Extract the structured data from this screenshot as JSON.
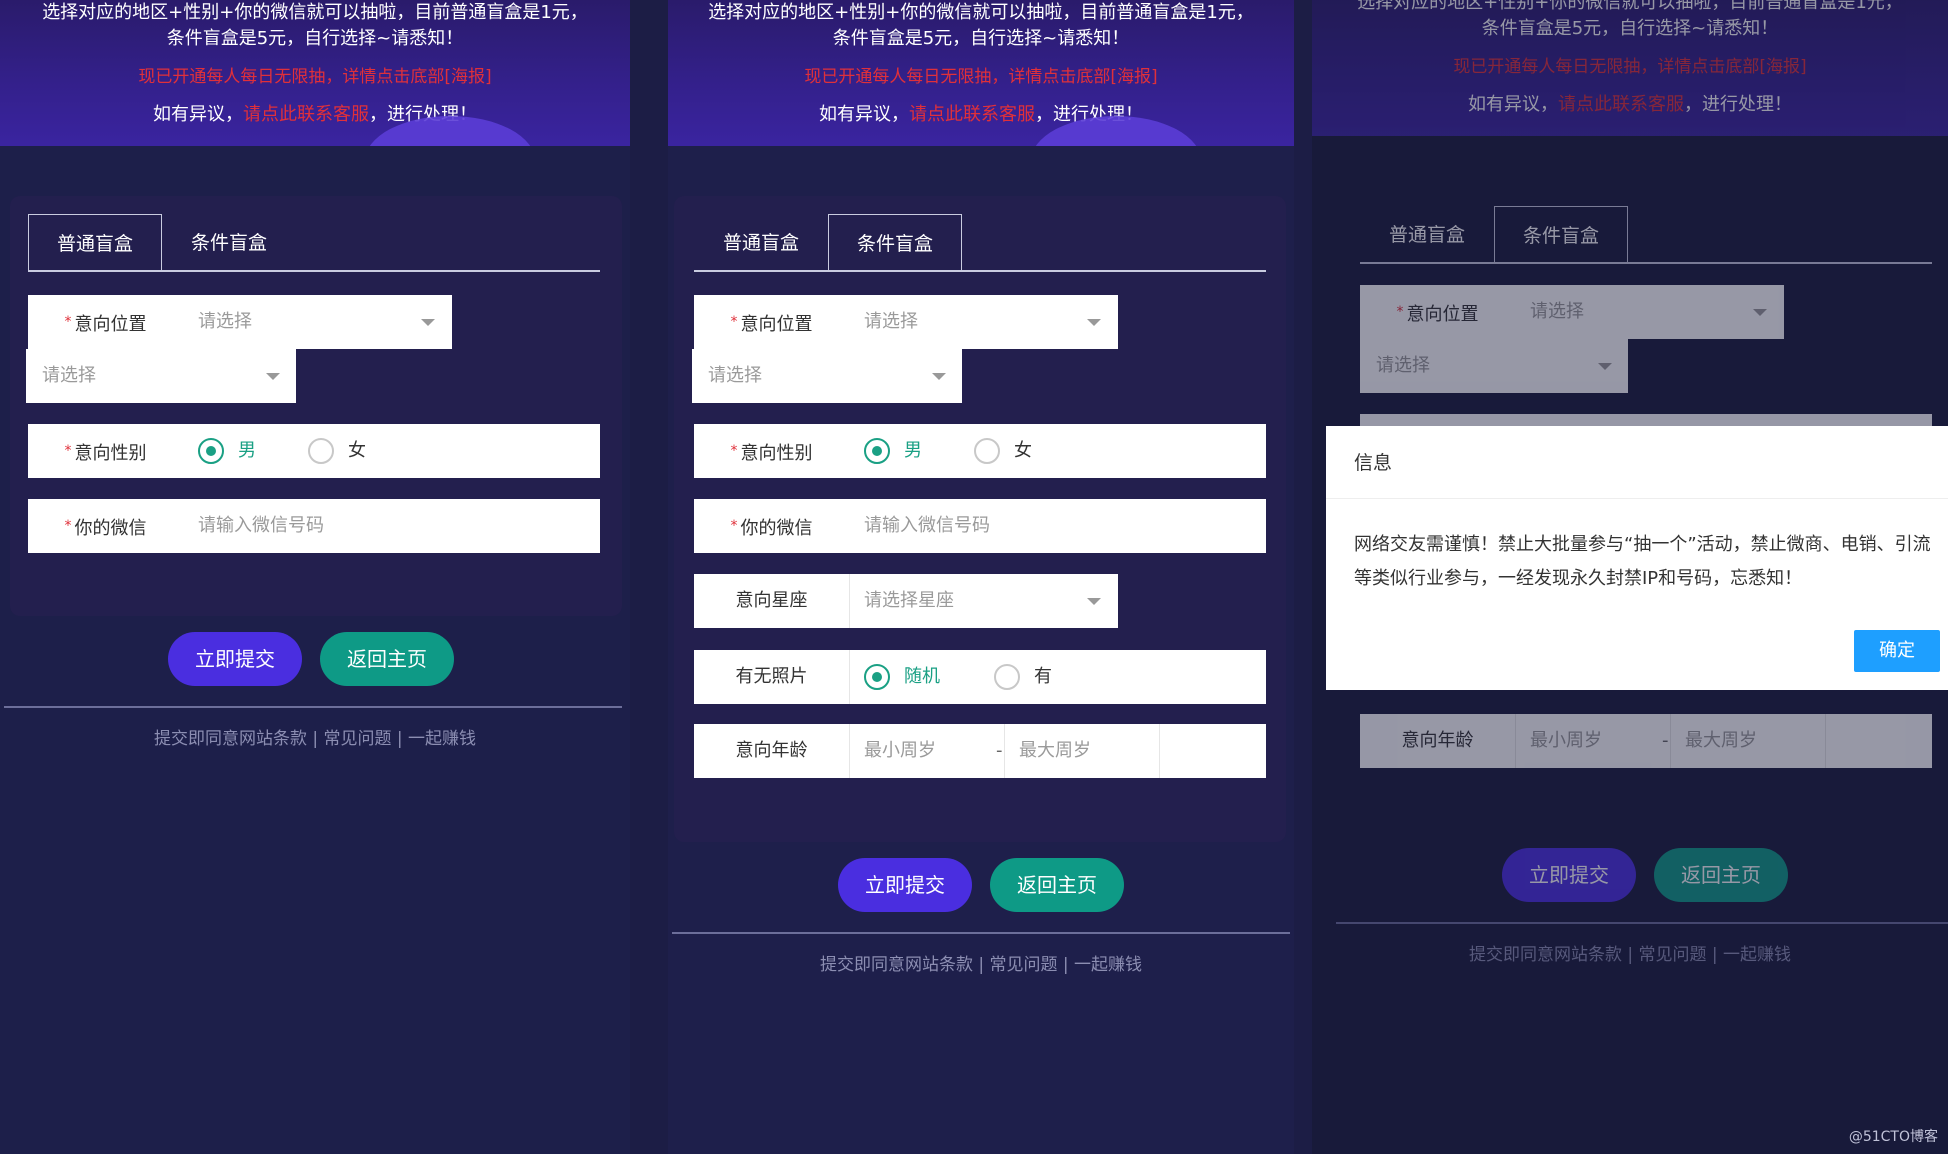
{
  "banner": {
    "line1": "选择对应的地区+性别+你的微信就可以抽啦，目前普通盲盒是1元，",
    "line2": "条件盲盒是5元，自行选择~请悉知！",
    "notice": "现已开通每人每日无限抽，详情点击底部[海报]",
    "dispute_prefix": "如有异议，",
    "dispute_link": "请点此联系客服",
    "dispute_suffix": "，进行处理！"
  },
  "tabs": {
    "normal": "普通盲盒",
    "conditional": "条件盲盒"
  },
  "form": {
    "location_label": "意向位置",
    "select_placeholder": "请选择",
    "gender_label": "意向性别",
    "gender_male": "男",
    "gender_female": "女",
    "wechat_label": "你的微信",
    "wechat_placeholder": "请输入微信号码",
    "zodiac_label": "意向星座",
    "zodiac_placeholder": "请选择星座",
    "photo_label": "有无照片",
    "photo_random": "随机",
    "photo_yes": "有",
    "age_label": "意向年龄",
    "age_min": "最小周岁",
    "age_dash": "-",
    "age_max": "最大周岁",
    "required_mark": "*"
  },
  "buttons": {
    "submit": "立即提交",
    "home": "返回主页"
  },
  "footer": {
    "links": "提交即同意网站条款 | 常见问题 | 一起赚钱"
  },
  "dialog": {
    "title": "信息",
    "body": "网络交友需谨慎！禁止大批量参与“抽一个”活动，禁止微商、电销、引流等类似行业参与，一经发现永久封禁IP和号码，忘悉知！",
    "ok": "确定"
  },
  "watermark": "@51CTO博客",
  "colors": {
    "background": "#1c1d45",
    "accent_purple": "#4a2ee0",
    "accent_teal": "#0e9a86",
    "required_red": "#e0303a",
    "dialog_button": "#1e9fff"
  }
}
